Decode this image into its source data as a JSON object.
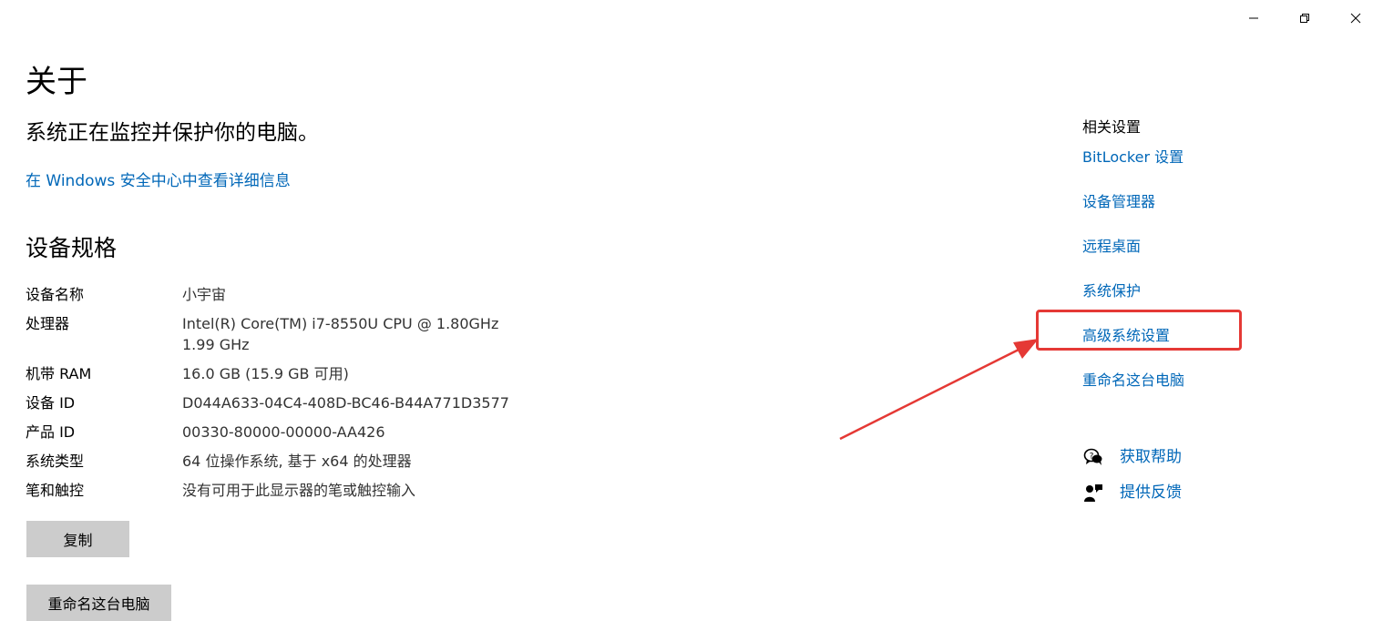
{
  "window": {
    "controls": {
      "minimize": "minimize-icon",
      "maximize": "restore-icon",
      "close": "close-icon"
    }
  },
  "header": {
    "title": "关于",
    "status": "系统正在监控并保护你的电脑。",
    "security_link": "在 Windows 安全中心中查看详细信息"
  },
  "specs": {
    "title": "设备规格",
    "rows": [
      {
        "label": "设备名称",
        "value": "小宇宙"
      },
      {
        "label": "处理器",
        "value": "Intel(R) Core(TM) i7-8550U CPU @ 1.80GHz   1.99 GHz"
      },
      {
        "label": "机带 RAM",
        "value": "16.0 GB (15.9 GB 可用)"
      },
      {
        "label": "设备 ID",
        "value": "D044A633-04C4-408D-BC46-B44A771D3577"
      },
      {
        "label": "产品 ID",
        "value": "00330-80000-00000-AA426"
      },
      {
        "label": "系统类型",
        "value": "64 位操作系统, 基于 x64 的处理器"
      },
      {
        "label": "笔和触控",
        "value": "没有可用于此显示器的笔或触控输入"
      }
    ]
  },
  "buttons": {
    "copy": "复制",
    "rename": "重命名这台电脑"
  },
  "related": {
    "title": "相关设置",
    "links": [
      "BitLocker 设置",
      "设备管理器",
      "远程桌面",
      "系统保护",
      "高级系统设置",
      "重命名这台电脑"
    ]
  },
  "help": {
    "get_help": "获取帮助",
    "feedback": "提供反馈"
  },
  "annotation": {
    "color": "#e53935"
  },
  "colors": {
    "link": "#0067b8",
    "button_bg": "#cccccc"
  }
}
